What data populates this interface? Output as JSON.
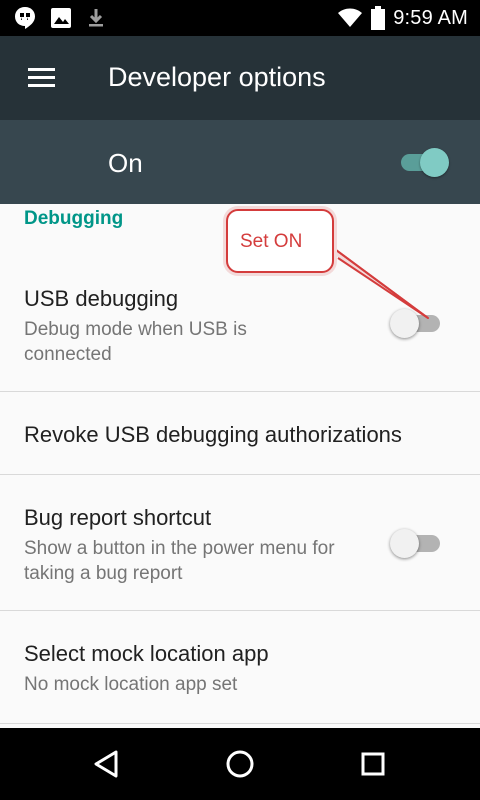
{
  "status_bar": {
    "time": "9:59 AM",
    "icons": [
      "hangouts-icon",
      "image-icon",
      "download-icon",
      "wifi-icon",
      "battery-icon"
    ]
  },
  "toolbar": {
    "title": "Developer options",
    "menu_icon": "menu-icon"
  },
  "master_toggle": {
    "label": "On",
    "state": "on",
    "accent": "#80cbc4"
  },
  "section": {
    "header": "Debugging",
    "accent": "#009688"
  },
  "settings": [
    {
      "title": "USB debugging",
      "subtitle": "Debug mode when USB is connected",
      "toggle": "off"
    },
    {
      "title": "Revoke USB debugging authorizations"
    },
    {
      "title": "Bug report shortcut",
      "subtitle": "Show a button in the power menu for taking a bug report",
      "toggle": "off"
    },
    {
      "title": "Select mock location app",
      "subtitle": "No mock location app set"
    }
  ],
  "annotation": {
    "text": "Set ON",
    "color": "#d43c3c"
  },
  "nav_bar": {
    "buttons": [
      "back-icon",
      "home-icon",
      "recents-icon"
    ]
  }
}
